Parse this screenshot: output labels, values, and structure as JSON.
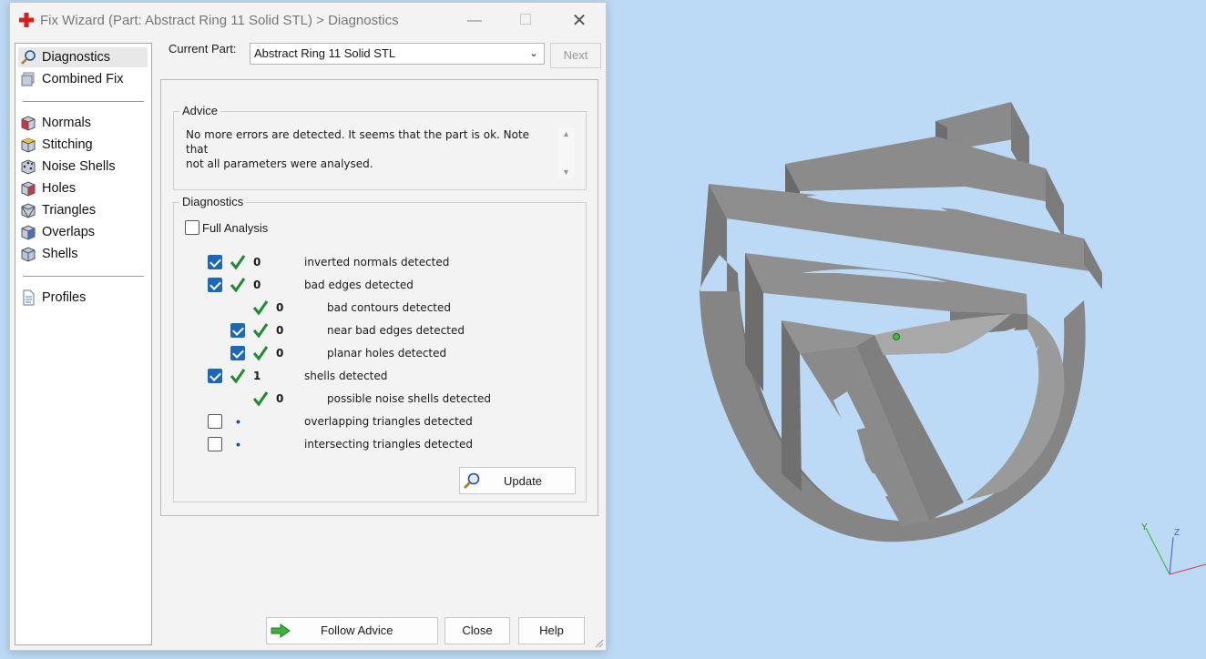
{
  "window": {
    "title": "Fix Wizard (Part: Abstract Ring 11 Solid STL) > Diagnostics",
    "minimize_label": "—",
    "maximize_label": "☐",
    "close_label": "✕"
  },
  "sidebar": {
    "items": [
      {
        "label": "Diagnostics",
        "icon": "magnifier-icon"
      },
      {
        "label": "Combined Fix",
        "icon": "combined-fix-icon"
      },
      {
        "label": "Normals",
        "icon": "normals-cube-icon"
      },
      {
        "label": "Stitching",
        "icon": "stitching-cube-icon"
      },
      {
        "label": "Noise Shells",
        "icon": "noise-shells-cube-icon"
      },
      {
        "label": "Holes",
        "icon": "holes-cube-icon"
      },
      {
        "label": "Triangles",
        "icon": "triangles-cube-icon"
      },
      {
        "label": "Overlaps",
        "icon": "overlaps-cube-icon"
      },
      {
        "label": "Shells",
        "icon": "shells-cube-icon"
      },
      {
        "label": "Profiles",
        "icon": "document-icon"
      }
    ],
    "selected": "Diagnostics"
  },
  "header": {
    "current_part_label": "Current Part:",
    "current_part_value": "Abstract Ring 11 Solid STL",
    "next_label": "Next"
  },
  "advice": {
    "title": "Advice",
    "text_line1": "No more errors are detected. It seems that the part is ok. Note that",
    "text_line2": "not all parameters were analysed."
  },
  "diagnostics": {
    "title": "Diagnostics",
    "full_analysis_label": "Full Analysis",
    "full_analysis_checked": false,
    "rows": [
      {
        "count": "0",
        "label": "inverted normals detected",
        "checked": true,
        "status": "ok"
      },
      {
        "count": "0",
        "label": "bad edges detected",
        "checked": true,
        "status": "ok"
      },
      {
        "count": "0",
        "label": "bad contours detected",
        "checked": null,
        "status": "ok"
      },
      {
        "count": "0",
        "label": "near bad edges detected",
        "checked": true,
        "status": "ok"
      },
      {
        "count": "0",
        "label": "planar holes detected",
        "checked": true,
        "status": "ok"
      },
      {
        "count": "1",
        "label": "shells detected",
        "checked": true,
        "status": "ok"
      },
      {
        "count": "0",
        "label": "possible noise shells detected",
        "checked": null,
        "status": "ok"
      },
      {
        "count": "",
        "label": "overlapping triangles detected",
        "checked": false,
        "status": "pending"
      },
      {
        "count": "",
        "label": "intersecting triangles detected",
        "checked": false,
        "status": "pending"
      }
    ],
    "update_label": "Update"
  },
  "footer": {
    "follow_advice_label": "Follow Advice",
    "close_label": "Close",
    "help_label": "Help"
  },
  "viewport": {
    "axis_y_label": "Y",
    "axis_z_label": "Z"
  },
  "colors": {
    "viewport_bg": "#bcdaf5",
    "checkbox_blue": "#1d67b8",
    "tick_green": "#1f8a2e"
  }
}
